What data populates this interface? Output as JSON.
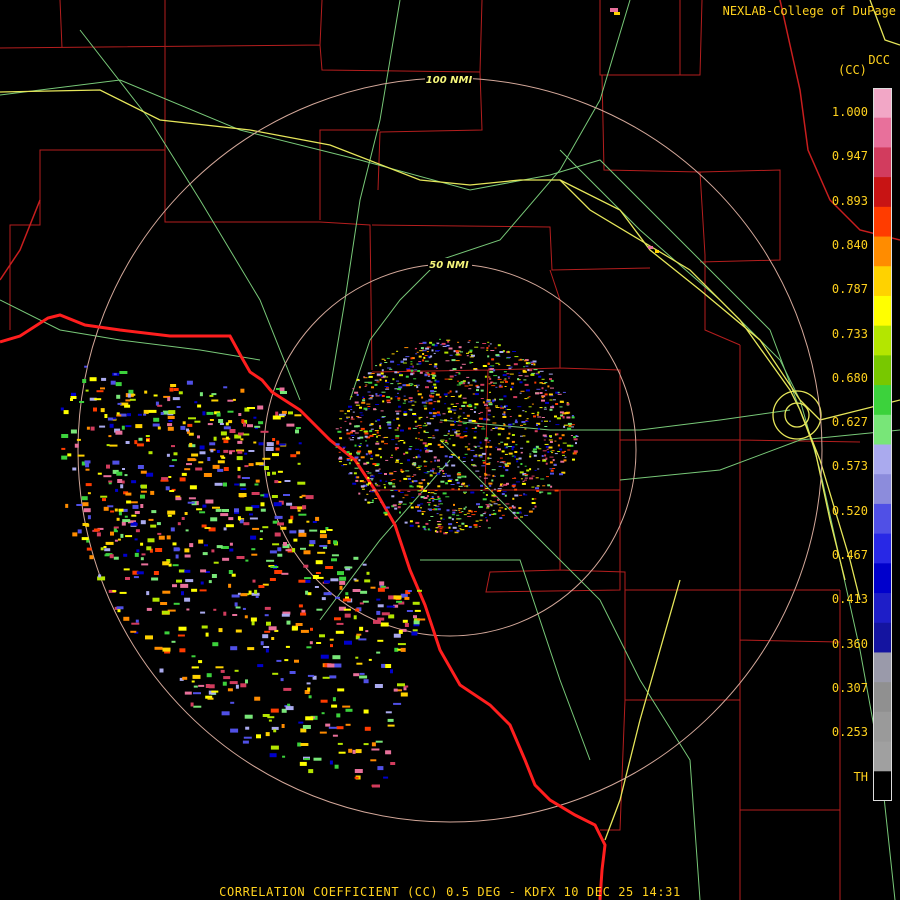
{
  "header": {
    "credit": "NEXLAB-College of DuPage"
  },
  "legend": {
    "product_code": "DCC",
    "unit": "(CC)",
    "ticks": [
      "1.000",
      "0.947",
      "0.893",
      "0.840",
      "0.787",
      "0.733",
      "0.680",
      "0.627",
      "0.573",
      "0.520",
      "0.467",
      "0.413",
      "0.360",
      "0.307",
      "0.253",
      "TH"
    ],
    "colors": [
      "#f2a7c6",
      "#e8709b",
      "#d23c5e",
      "#c81414",
      "#ff3c00",
      "#ff8c00",
      "#ffd200",
      "#ffff00",
      "#b4e600",
      "#78c800",
      "#3cd23c",
      "#78e678",
      "#aaaaee",
      "#8c8cdc",
      "#5050e6",
      "#2828e6",
      "#0000cc",
      "#1e1ec8",
      "#1414a0",
      "#9a9aaa",
      "#909090",
      "#9a9a9a",
      "#a0a0a0",
      "#000000"
    ]
  },
  "map": {
    "range_rings": [
      {
        "label": "100 NMI",
        "radius_nmi": 100
      },
      {
        "label": "50 NMI",
        "radius_nmi": 50
      }
    ],
    "radar_site": "KDFX",
    "colors": {
      "county": "#b41e1e",
      "state": "#ff1e1e",
      "highway": "#78c878",
      "interstate": "#e6e65a",
      "ring": "#d4a89a"
    }
  },
  "footer": {
    "caption": "CORRELATION COEFFICIENT (CC) 0.5 DEG - KDFX 10 DEC 25 14:31"
  }
}
